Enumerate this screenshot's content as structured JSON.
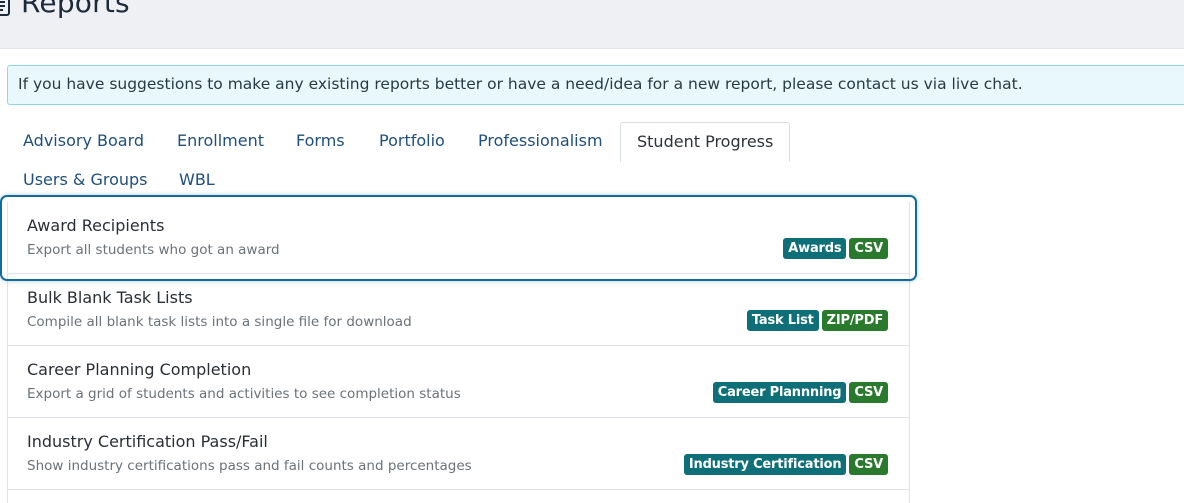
{
  "header": {
    "title": "Reports",
    "icon": "report-icon"
  },
  "notice": {
    "text": "If you have suggestions to make any existing reports better or have a need/idea for a new report, please contact us via live chat."
  },
  "tabs": [
    {
      "label": "Advisory Board",
      "active": false
    },
    {
      "label": "Enrollment",
      "active": false
    },
    {
      "label": "Forms",
      "active": false
    },
    {
      "label": "Portfolio",
      "active": false
    },
    {
      "label": "Professionalism",
      "active": false
    },
    {
      "label": "Student Progress",
      "active": true
    },
    {
      "label": "Users & Groups",
      "active": false
    },
    {
      "label": "WBL",
      "active": false
    }
  ],
  "reports": [
    {
      "title": "Award Recipients",
      "description": "Export all students who got an award",
      "category": "Awards",
      "format": "CSV",
      "focused": true
    },
    {
      "title": "Bulk Blank Task Lists",
      "description": "Compile all blank task lists into a single file for download",
      "category": "Task List",
      "format": "ZIP/PDF",
      "focused": false
    },
    {
      "title": "Career Planning Completion",
      "description": "Export a grid of students and activities to see completion status",
      "category": "Career Plannning",
      "format": "CSV",
      "focused": false
    },
    {
      "title": "Industry Certification Pass/Fail",
      "description": "Show industry certifications pass and fail counts and percentages",
      "category": "Industry Certification",
      "format": "CSV",
      "focused": false
    }
  ],
  "colors": {
    "category_badge": "#0f6f78",
    "format_badge": "#2a7a2e",
    "focus_ring": "#136a9c",
    "link": "#1f4f7a"
  }
}
